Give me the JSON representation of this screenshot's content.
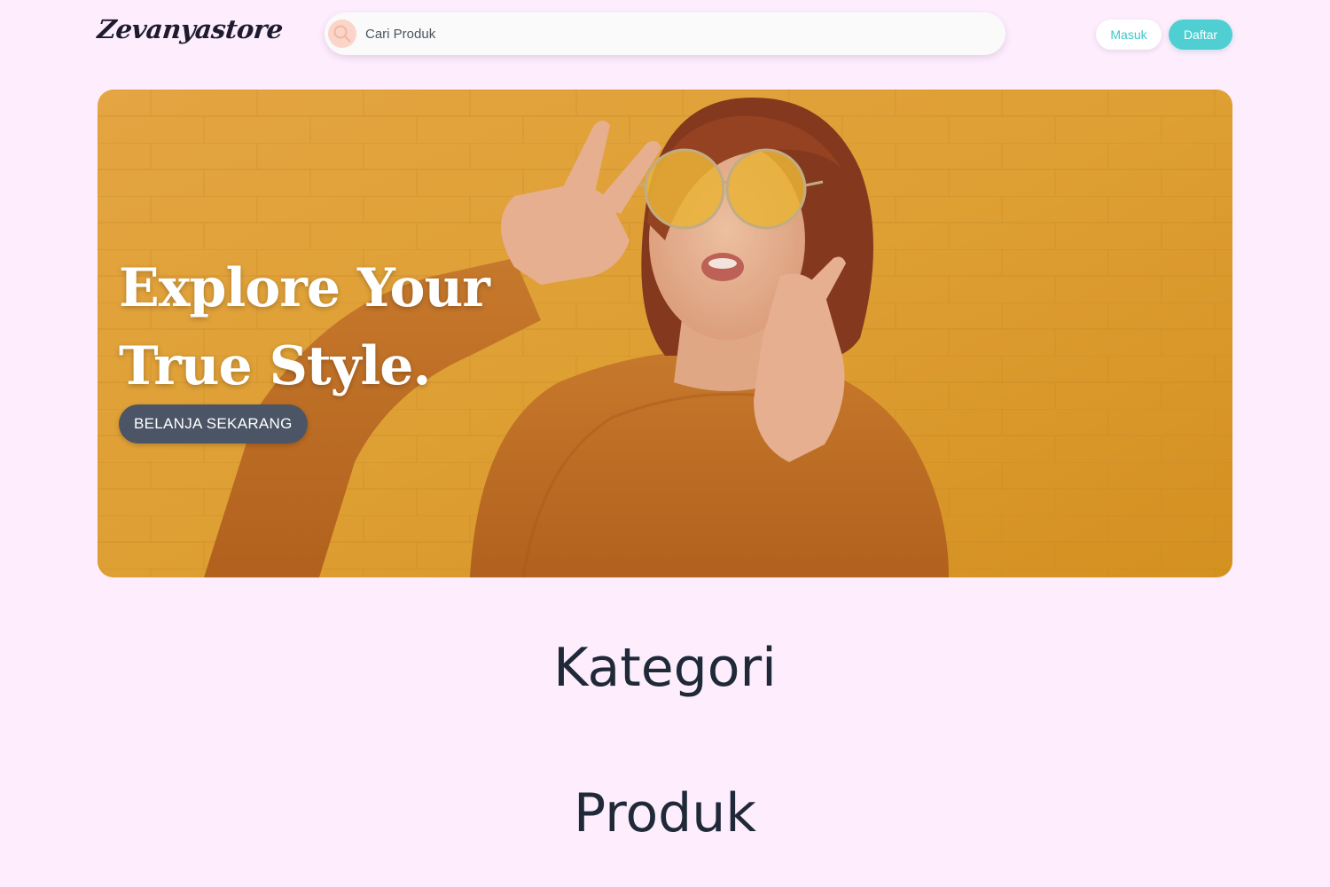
{
  "header": {
    "logo_text": "Zevanyastore",
    "search": {
      "placeholder": "Cari Produk",
      "icon": "search-icon"
    },
    "login_label": "Masuk",
    "register_label": "Daftar"
  },
  "hero": {
    "title_line1": "Explore Your",
    "title_line2": "True Style.",
    "cta_label": "BELANJA SEKARANG",
    "image": "woman-in-yellow-sunglasses-and-orange-sweater"
  },
  "sections": {
    "category_title": "Kategori",
    "product_title": "Produk"
  },
  "colors": {
    "page_background": "#fdedfd",
    "accent_teal": "#4fcfd2",
    "cta_background": "#4b5565",
    "hero_yellow": "#e8a636",
    "search_icon_bg": "#fbd5c9"
  }
}
